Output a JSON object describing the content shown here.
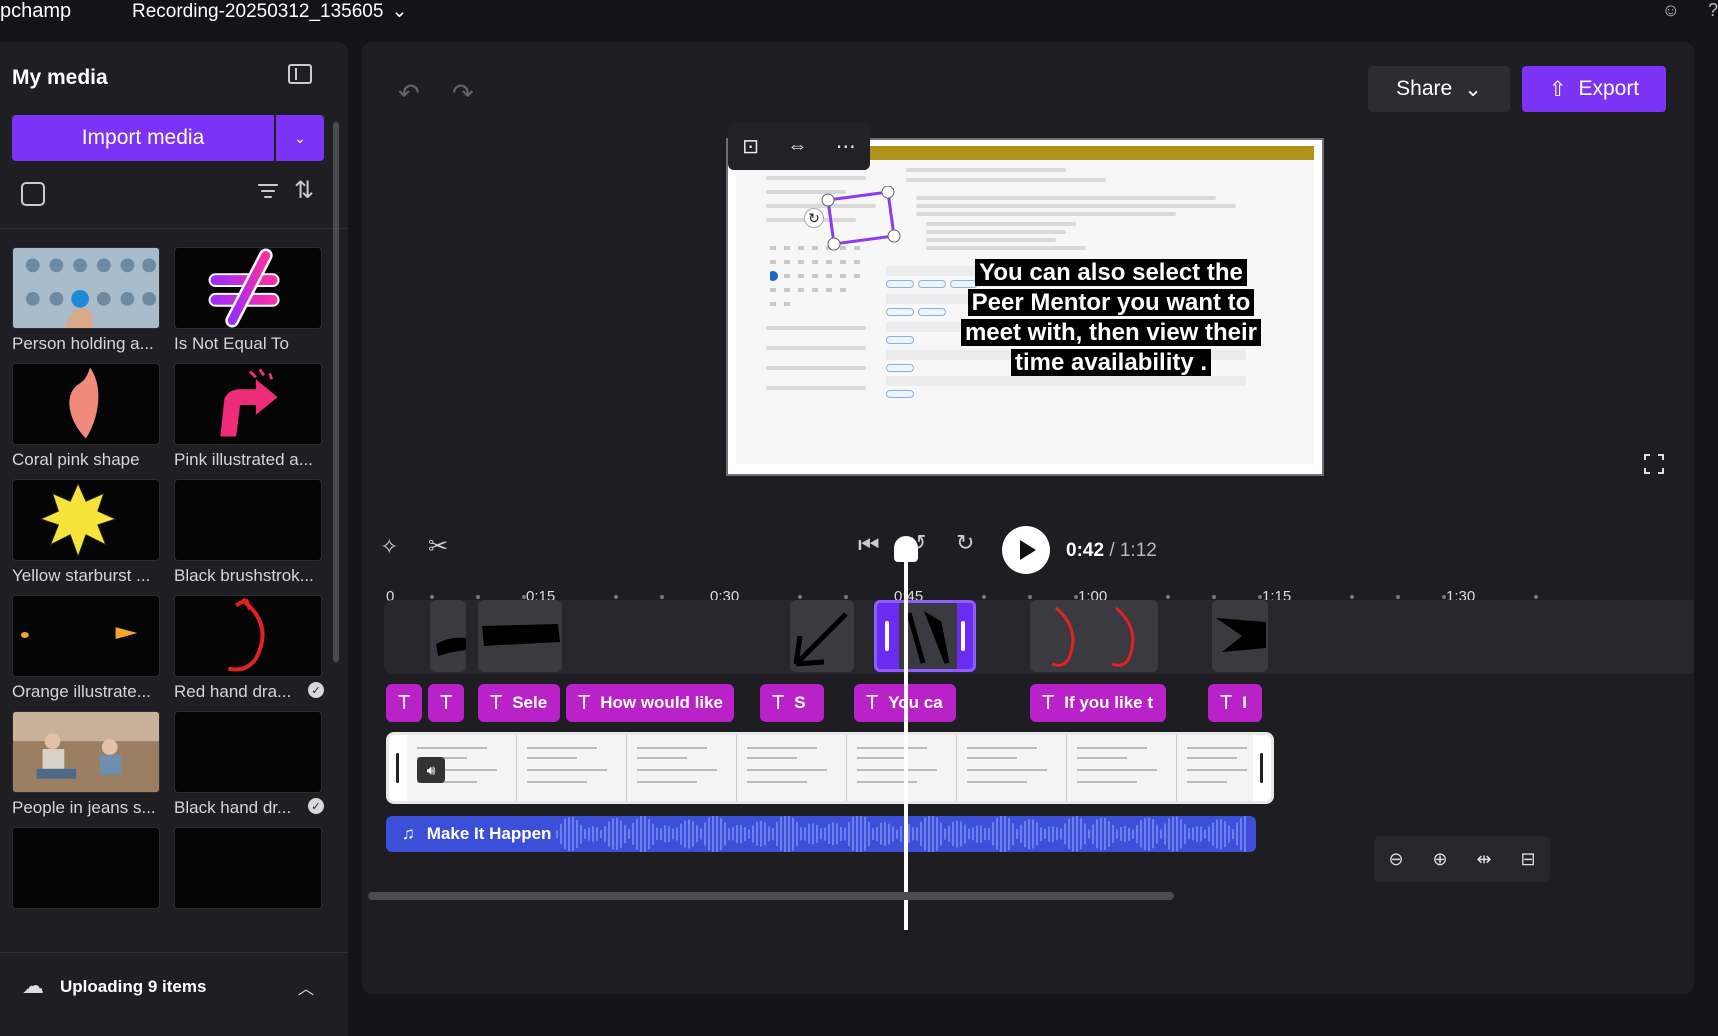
{
  "app": {
    "name": "pchamp",
    "project_title": "Recording-20250312_135605"
  },
  "media_panel": {
    "title": "My media",
    "import_label": "Import media",
    "items": [
      {
        "label": "Person holding a..."
      },
      {
        "label": "Is Not Equal To"
      },
      {
        "label": "Coral pink shape"
      },
      {
        "label": "Pink illustrated a..."
      },
      {
        "label": "Yellow starburst ..."
      },
      {
        "label": "Black brushstrok..."
      },
      {
        "label": "Orange illustrate..."
      },
      {
        "label": "Red hand dra..."
      },
      {
        "label": "People in jeans s..."
      },
      {
        "label": "Black hand dr..."
      }
    ],
    "uploading_text": "Uploading 9 items"
  },
  "toolbar": {
    "share_label": "Share",
    "export_label": "Export"
  },
  "preview": {
    "caption": "You can also select the Peer Mentor you want to meet with, then view their time availability ."
  },
  "playback": {
    "current_time": "0:42",
    "total_time": "/ 1:12"
  },
  "ruler": {
    "labels": [
      "0",
      "0:15",
      "0:30",
      "0:45",
      "1:00",
      "1:15",
      "1:30"
    ]
  },
  "text_clips": [
    {
      "label": ""
    },
    {
      "label": ""
    },
    {
      "label": "Sele"
    },
    {
      "label": "How would like"
    },
    {
      "label": "S"
    },
    {
      "label": "You ca"
    },
    {
      "label": "If you like t"
    },
    {
      "label": "I"
    }
  ],
  "audio": {
    "label": "Make It Happen"
  },
  "colors": {
    "accent": "#7b34f5",
    "text_clip": "#b822c8",
    "audio_clip": "#3b4fd8"
  }
}
